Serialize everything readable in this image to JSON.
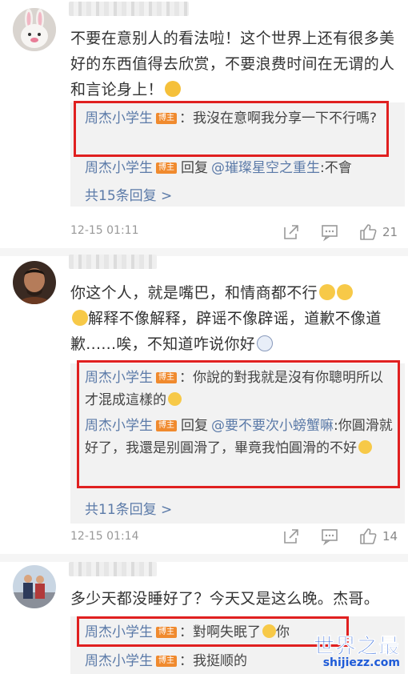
{
  "comments": [
    {
      "text": "不要在意别人的看法啦！这个世界上还有很多美好的东西值得去欣赏，不要浪费时间在无谓的人和言论身上！",
      "replies": [
        {
          "name": "周杰小学生",
          "badge": "博主",
          "sep": "：",
          "text": "我沒在意啊我分享一下不行嗎?"
        },
        {
          "name": "周杰小学生",
          "badge": "博主",
          "reply_word": "回复",
          "at": "@璀璨星空之重生",
          "sep": ":",
          "text": "不會"
        }
      ],
      "more": "共15条回复 >",
      "time": "12-15 01:11",
      "likes": "21"
    },
    {
      "text": "你这个人，就是嘴巴，和情商都不行",
      "text2": "解释不像解释，辟谣不像辟谣，道歉不像道歉......唉，不知道咋说你好",
      "replies": [
        {
          "name": "周杰小学生",
          "badge": "博主",
          "sep": "：",
          "text": "你說的對我就是沒有你聰明所以才混成這樣的"
        },
        {
          "name": "周杰小学生",
          "badge": "博主",
          "reply_word": "回复",
          "at": "@要不要次小螃蟹嘛",
          "sep": ":",
          "text": "你圓滑就好了，我還是别圓滑了，畢竟我怕圓滑的不好"
        }
      ],
      "more": "共11条回复 >",
      "time": "12-15 01:14",
      "likes": "14"
    },
    {
      "text": "多少天都没睡好了？今天又是这么晚。杰哥。",
      "replies": [
        {
          "name": "周杰小学生",
          "badge": "博主",
          "sep": "：",
          "text": "對啊失眠了",
          "text_after": "你"
        },
        {
          "name": "周杰小学生",
          "badge": "博主",
          "sep": "：",
          "text": "我挺顺的"
        }
      ]
    }
  ],
  "watermark": {
    "title": "世界之最",
    "url": "shijiezz.com"
  },
  "colors": {
    "name_blue": "#5b7aa8",
    "badge_orange": "#f08a2e",
    "highlight_red": "#e02020",
    "watermark_blue": "#1e5bd8"
  }
}
